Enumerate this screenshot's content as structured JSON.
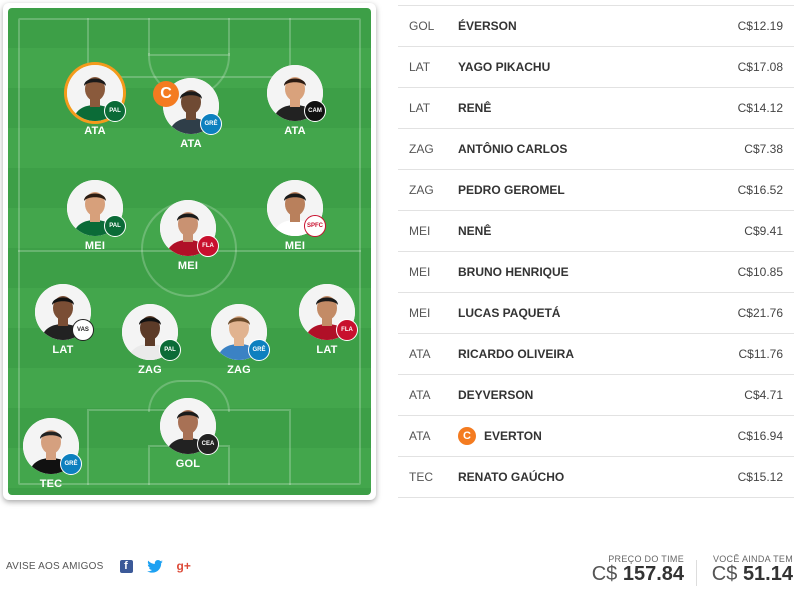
{
  "captain_symbol": "C",
  "field_players": [
    {
      "id": "ata-ricardo",
      "pos": "ATA",
      "club": "Palmeiras",
      "crest_abbr": "PAL",
      "crest_class": "c-palmeiras",
      "highlight": true,
      "skin": "#8a5a3c",
      "hair": "#1a1a1a",
      "shirt": "#0b6b37"
    },
    {
      "id": "ata-everton",
      "pos": "ATA",
      "club": "Grêmio",
      "crest_abbr": "GRÊ",
      "crest_class": "c-gremio",
      "highlight": false,
      "skin": "#6f4a33",
      "hair": "#1a1a1a",
      "shirt": "#2f3e49"
    },
    {
      "id": "ata-deyverson",
      "pos": "ATA",
      "club": "Atlético-MG",
      "crest_abbr": "CAM",
      "crest_class": "c-atletico",
      "highlight": false,
      "skin": "#d9a27c",
      "hair": "#2a1a12",
      "shirt": "#222"
    },
    {
      "id": "mei-bruno",
      "pos": "MEI",
      "club": "Palmeiras",
      "crest_abbr": "PAL",
      "crest_class": "c-palmeiras",
      "highlight": false,
      "skin": "#d7a07b",
      "hair": "#2b1c12",
      "shirt": "#0b6b37"
    },
    {
      "id": "mei-paqueta",
      "pos": "MEI",
      "club": "Flamengo",
      "crest_abbr": "FLA",
      "crest_class": "c-flamengo",
      "highlight": false,
      "skin": "#c99272",
      "hair": "#1a1a1a",
      "shirt": "#b01027"
    },
    {
      "id": "mei-nene",
      "pos": "MEI",
      "club": "São Paulo",
      "crest_abbr": "SPFC",
      "crest_class": "c-saopaulo",
      "highlight": false,
      "skin": "#b9805c",
      "hair": "#1a1a1a",
      "shirt": "#ffffff"
    },
    {
      "id": "lat-yago",
      "pos": "LAT",
      "club": "Vasco",
      "crest_abbr": "VAS",
      "crest_class": "c-vasco",
      "highlight": false,
      "skin": "#7a4e35",
      "hair": "#111",
      "shirt": "#222"
    },
    {
      "id": "zag-antonio",
      "pos": "ZAG",
      "club": "Palmeiras",
      "crest_abbr": "PAL",
      "crest_class": "c-palmeiras",
      "highlight": false,
      "skin": "#5c3b28",
      "hair": "#111",
      "shirt": "#eaeaea"
    },
    {
      "id": "zag-geromel",
      "pos": "ZAG",
      "club": "Grêmio",
      "crest_abbr": "GRÊ",
      "crest_class": "c-gremio",
      "highlight": false,
      "skin": "#e1b390",
      "hair": "#6b4a2a",
      "shirt": "#3b82c4"
    },
    {
      "id": "lat-rene",
      "pos": "LAT",
      "club": "Flamengo",
      "crest_abbr": "FLA",
      "crest_class": "c-flamengo",
      "highlight": false,
      "skin": "#c38b66",
      "hair": "#1a1a1a",
      "shirt": "#b01027"
    },
    {
      "id": "gol-everson",
      "pos": "GOL",
      "club": "Ceará",
      "crest_abbr": "CEA",
      "crest_class": "c-ceara",
      "highlight": false,
      "skin": "#a87155",
      "hair": "#1a1a1a",
      "shirt": "#222"
    },
    {
      "id": "tec-renato",
      "pos": "TEC",
      "club": "Grêmio",
      "crest_abbr": "GRÊ",
      "crest_class": "c-gremio",
      "highlight": false,
      "skin": "#d5a07f",
      "hair": "#222",
      "shirt": "#111"
    }
  ],
  "roster": [
    {
      "pos": "GOL",
      "name": "ÉVERSON",
      "price": "C$12.19",
      "captain": false
    },
    {
      "pos": "LAT",
      "name": "YAGO PIKACHU",
      "price": "C$17.08",
      "captain": false
    },
    {
      "pos": "LAT",
      "name": "RENÊ",
      "price": "C$14.12",
      "captain": false
    },
    {
      "pos": "ZAG",
      "name": "ANTÔNIO CARLOS",
      "price": "C$7.38",
      "captain": false
    },
    {
      "pos": "ZAG",
      "name": "PEDRO GEROMEL",
      "price": "C$16.52",
      "captain": false
    },
    {
      "pos": "MEI",
      "name": "NENÊ",
      "price": "C$9.41",
      "captain": false
    },
    {
      "pos": "MEI",
      "name": "BRUNO HENRIQUE",
      "price": "C$10.85",
      "captain": false
    },
    {
      "pos": "MEI",
      "name": "LUCAS PAQUETÁ",
      "price": "C$21.76",
      "captain": false
    },
    {
      "pos": "ATA",
      "name": "RICARDO OLIVEIRA",
      "price": "C$11.76",
      "captain": false
    },
    {
      "pos": "ATA",
      "name": "DEYVERSON",
      "price": "C$4.71",
      "captain": false
    },
    {
      "pos": "ATA",
      "name": "EVERTON",
      "price": "C$16.94",
      "captain": true
    },
    {
      "pos": "TEC",
      "name": "RENATO GAÚCHO",
      "price": "C$15.12",
      "captain": false
    }
  ],
  "footer": {
    "share_label": "AVISE AOS AMIGOS",
    "share_icons": {
      "facebook": "f",
      "twitter": "🐦",
      "googleplus": "g+"
    },
    "team_price_label": "PREÇO DO TIME",
    "team_price_currency": "C$",
    "team_price_value": "157.84",
    "balance_label": "VOCÊ AINDA TEM",
    "balance_currency": "C$",
    "balance_value": "51.14"
  },
  "colors": {
    "captain": "#f47b20",
    "pitch": "#43a64c",
    "highlight_ring": "#f49b1c"
  }
}
